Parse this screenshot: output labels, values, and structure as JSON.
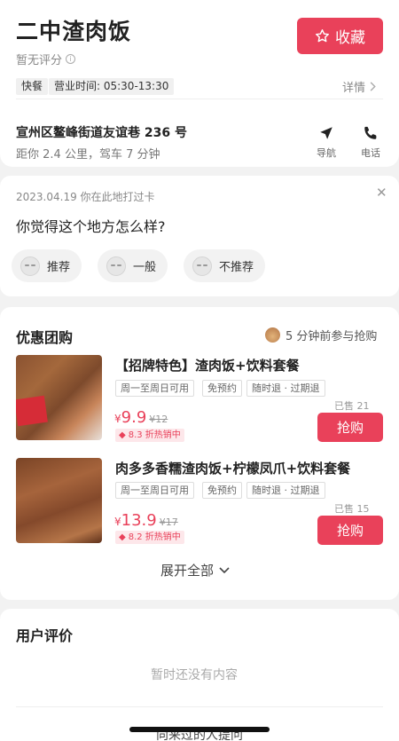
{
  "header": {
    "title": "二中渣肉饭",
    "favorite_label": "收藏",
    "rating_text": "暂无评分",
    "tags": [
      "快餐",
      "营业时间: 05:30-13:30"
    ],
    "details_label": "详情",
    "address": "宣州区鳌峰街道友谊巷 236 号",
    "distance": "距你 2.4 公里，驾车 7 分钟",
    "nav_label": "导航",
    "phone_label": "电话"
  },
  "checkin": {
    "text": "2023.04.19 你在此地打过卡",
    "question": "你觉得这个地方怎么样?",
    "options": [
      "推荐",
      "一般",
      "不推荐"
    ]
  },
  "deals": {
    "title": "优惠团购",
    "recent_grab": "5 分钟前参与抢购",
    "items": [
      {
        "title": "【招牌特色】渣肉饭+饮料套餐",
        "chips": [
          "周一至周日可用",
          "免预约",
          "随时退 · 过期退"
        ],
        "currency": "¥",
        "price": "9.9",
        "original_price": "¥12",
        "discount": "8.3 折热销中",
        "sold": "已售 21",
        "buy_label": "抢购"
      },
      {
        "title": "肉多多香糯渣肉饭+柠檬凤爪+饮料套餐",
        "chips": [
          "周一至周日可用",
          "免预约",
          "随时退 · 过期退"
        ],
        "currency": "¥",
        "price": "13.9",
        "original_price": "¥17",
        "discount": "8.2 折热销中",
        "sold": "已售 15",
        "buy_label": "抢购"
      }
    ],
    "expand_label": "展开全部"
  },
  "reviews": {
    "title": "用户评价",
    "empty_text": "暂时还没有内容",
    "ask_label": "向来过的人提问"
  },
  "colors": {
    "accent": "#e9415a"
  }
}
